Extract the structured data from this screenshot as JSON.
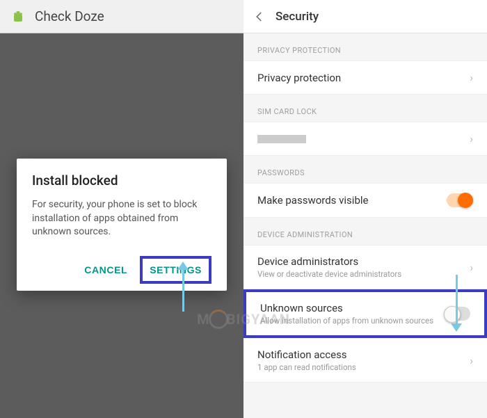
{
  "left": {
    "app_title": "Check Doze",
    "dialog": {
      "title": "Install blocked",
      "body": "For security, your phone is set to block installation of apps obtained from unknown sources.",
      "cancel": "CANCEL",
      "settings": "SETTINGS"
    }
  },
  "right": {
    "title": "Security",
    "sections": {
      "privacy_label": "PRIVACY PROTECTION",
      "privacy_item": "Privacy protection",
      "sim_label": "SIM CARD LOCK",
      "passwords_label": "PASSWORDS",
      "passwords_item": "Make passwords visible",
      "device_admin_label": "DEVICE ADMINISTRATION",
      "device_admin_item": "Device administrators",
      "device_admin_sub": "View or deactivate device administrators",
      "unknown_item": "Unknown sources",
      "unknown_sub": "Allow installation of apps from unknown sources",
      "notif_item": "Notification access",
      "notif_sub": "1 app can read notifications"
    }
  },
  "watermark": {
    "left": "M",
    "right": "BIGYAAN"
  }
}
